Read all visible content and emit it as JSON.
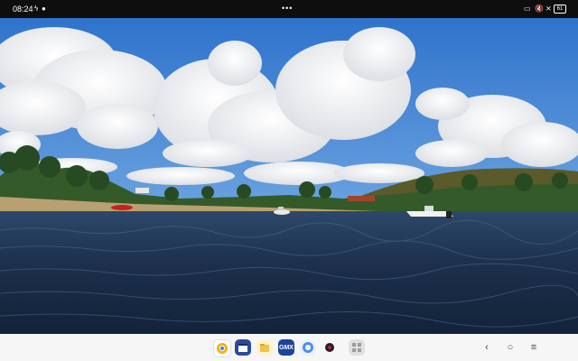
{
  "status_bar": {
    "time": "08:24",
    "battery_level": "61",
    "left_icons": [
      "charging-bolt-icon",
      "notification-dot-icon"
    ],
    "right_icons": [
      "cast-icon",
      "mute-icon",
      "wifi-off-icon",
      "battery-icon"
    ]
  },
  "photo": {
    "description_icon": "landscape-photo",
    "colors": {
      "sky": "#3a7fd0",
      "water": "#1f3552",
      "cloud": "#f2f2f2",
      "trees": "#3d5a2a"
    }
  },
  "taskbar": {
    "apps": [
      {
        "name": "chrome-app-icon",
        "color": "#f4b400"
      },
      {
        "name": "calendar-app-icon",
        "color": "#2c4a9a"
      },
      {
        "name": "files-app-icon",
        "color": "#f1c24c"
      },
      {
        "name": "gmx-app-icon",
        "color": "#1c449b",
        "label": "GMX"
      },
      {
        "name": "assistant-app-icon",
        "color": "#4a90e2"
      },
      {
        "name": "camera-app-icon",
        "color": "#202020"
      },
      {
        "name": "app-drawer-icon",
        "color": "#9c9c9c"
      }
    ],
    "nav": [
      "back-icon",
      "home-icon",
      "menu-icon"
    ]
  }
}
